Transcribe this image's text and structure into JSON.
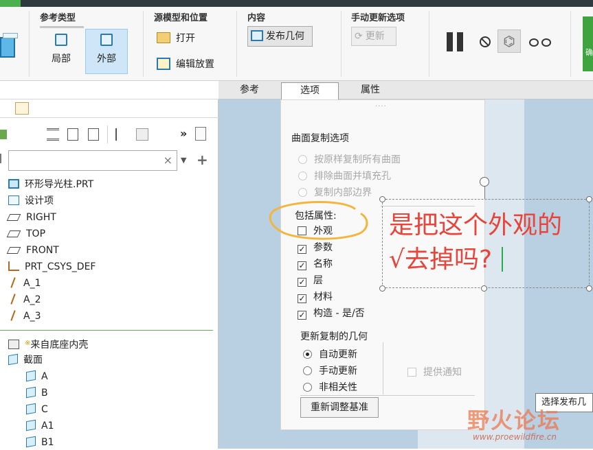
{
  "ribbon": {
    "groups": {
      "ref_type": {
        "title": "参考类型",
        "local": "局部",
        "external": "外部"
      },
      "source": {
        "title": "源模型和位置",
        "open": "打开",
        "edit_place": "编辑放置"
      },
      "content": {
        "title": "内容",
        "publish": "发布几何"
      },
      "manual_update": {
        "title": "手动更新选项",
        "update": "更新"
      }
    },
    "right_partial": "确"
  },
  "tabs": [
    "参考",
    "选项",
    "属性"
  ],
  "tree": {
    "search_clear": "×",
    "items": {
      "root": "环形导光柱.PRT",
      "design": "设计项",
      "right": "RIGHT",
      "top": "TOP",
      "front": "FRONT",
      "csys": "PRT_CSYS_DEF",
      "a1": "A_1",
      "a2": "A_2",
      "a3": "A_3",
      "from_base": "来自底座内壳",
      "section": "截面",
      "s_a": "A",
      "s_b": "B",
      "s_c": "C",
      "s_a1": "A1",
      "s_b1": "B1"
    }
  },
  "dialog": {
    "copy_options_title": "曲面复制选项",
    "copy_opt1": "按原样复制所有曲面",
    "copy_opt2": "排除曲面并填充孔",
    "copy_opt3": "复制内部边界",
    "include_attr_title": "包括属性:",
    "attrs": {
      "appearance": {
        "label": "外观",
        "checked": false
      },
      "params": {
        "label": "参数",
        "checked": true
      },
      "names": {
        "label": "名称",
        "checked": true
      },
      "layers": {
        "label": "层",
        "checked": true
      },
      "material": {
        "label": "材料",
        "checked": true
      },
      "construct": {
        "label": "构造 - 是/否",
        "checked": true
      }
    },
    "update_title": "更新复制的几何",
    "update_auto": "自动更新",
    "update_manual": "手动更新",
    "update_none": "非相关性",
    "notify": "提供通知",
    "reset_button": "重新调整基准"
  },
  "annotation": {
    "line1": "是把这个外观的",
    "line2": "√去掉吗?"
  },
  "tooltip": "选择发布几",
  "watermark": {
    "title": "野火论坛",
    "url": "www.proewildfire.cn"
  },
  "colors": {
    "annotation": "#e8443a",
    "highlight_circle": "#f2b63c",
    "selected_button": "#cfe6f8",
    "canvas": "#b9cfe2"
  }
}
